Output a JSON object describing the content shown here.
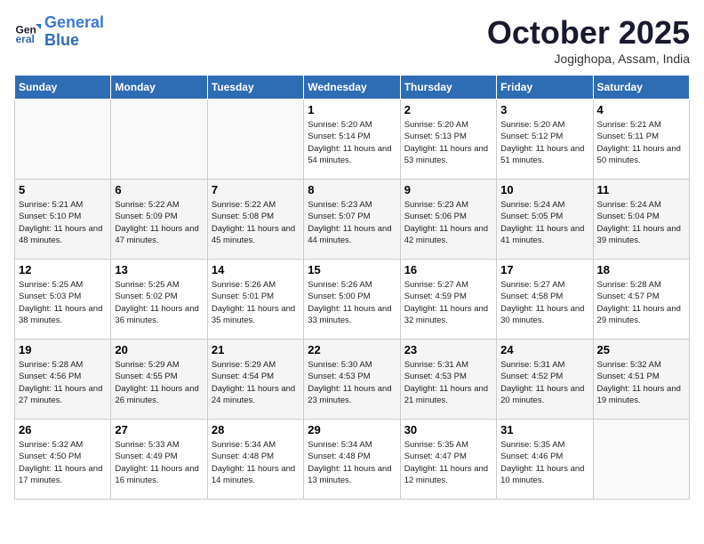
{
  "logo": {
    "line1": "General",
    "line2": "Blue"
  },
  "title": "October 2025",
  "subtitle": "Jogighopa, Assam, India",
  "days_of_week": [
    "Sunday",
    "Monday",
    "Tuesday",
    "Wednesday",
    "Thursday",
    "Friday",
    "Saturday"
  ],
  "weeks": [
    [
      {
        "num": "",
        "sunrise": "",
        "sunset": "",
        "daylight": ""
      },
      {
        "num": "",
        "sunrise": "",
        "sunset": "",
        "daylight": ""
      },
      {
        "num": "",
        "sunrise": "",
        "sunset": "",
        "daylight": ""
      },
      {
        "num": "1",
        "sunrise": "Sunrise: 5:20 AM",
        "sunset": "Sunset: 5:14 PM",
        "daylight": "Daylight: 11 hours and 54 minutes."
      },
      {
        "num": "2",
        "sunrise": "Sunrise: 5:20 AM",
        "sunset": "Sunset: 5:13 PM",
        "daylight": "Daylight: 11 hours and 53 minutes."
      },
      {
        "num": "3",
        "sunrise": "Sunrise: 5:20 AM",
        "sunset": "Sunset: 5:12 PM",
        "daylight": "Daylight: 11 hours and 51 minutes."
      },
      {
        "num": "4",
        "sunrise": "Sunrise: 5:21 AM",
        "sunset": "Sunset: 5:11 PM",
        "daylight": "Daylight: 11 hours and 50 minutes."
      }
    ],
    [
      {
        "num": "5",
        "sunrise": "Sunrise: 5:21 AM",
        "sunset": "Sunset: 5:10 PM",
        "daylight": "Daylight: 11 hours and 48 minutes."
      },
      {
        "num": "6",
        "sunrise": "Sunrise: 5:22 AM",
        "sunset": "Sunset: 5:09 PM",
        "daylight": "Daylight: 11 hours and 47 minutes."
      },
      {
        "num": "7",
        "sunrise": "Sunrise: 5:22 AM",
        "sunset": "Sunset: 5:08 PM",
        "daylight": "Daylight: 11 hours and 45 minutes."
      },
      {
        "num": "8",
        "sunrise": "Sunrise: 5:23 AM",
        "sunset": "Sunset: 5:07 PM",
        "daylight": "Daylight: 11 hours and 44 minutes."
      },
      {
        "num": "9",
        "sunrise": "Sunrise: 5:23 AM",
        "sunset": "Sunset: 5:06 PM",
        "daylight": "Daylight: 11 hours and 42 minutes."
      },
      {
        "num": "10",
        "sunrise": "Sunrise: 5:24 AM",
        "sunset": "Sunset: 5:05 PM",
        "daylight": "Daylight: 11 hours and 41 minutes."
      },
      {
        "num": "11",
        "sunrise": "Sunrise: 5:24 AM",
        "sunset": "Sunset: 5:04 PM",
        "daylight": "Daylight: 11 hours and 39 minutes."
      }
    ],
    [
      {
        "num": "12",
        "sunrise": "Sunrise: 5:25 AM",
        "sunset": "Sunset: 5:03 PM",
        "daylight": "Daylight: 11 hours and 38 minutes."
      },
      {
        "num": "13",
        "sunrise": "Sunrise: 5:25 AM",
        "sunset": "Sunset: 5:02 PM",
        "daylight": "Daylight: 11 hours and 36 minutes."
      },
      {
        "num": "14",
        "sunrise": "Sunrise: 5:26 AM",
        "sunset": "Sunset: 5:01 PM",
        "daylight": "Daylight: 11 hours and 35 minutes."
      },
      {
        "num": "15",
        "sunrise": "Sunrise: 5:26 AM",
        "sunset": "Sunset: 5:00 PM",
        "daylight": "Daylight: 11 hours and 33 minutes."
      },
      {
        "num": "16",
        "sunrise": "Sunrise: 5:27 AM",
        "sunset": "Sunset: 4:59 PM",
        "daylight": "Daylight: 11 hours and 32 minutes."
      },
      {
        "num": "17",
        "sunrise": "Sunrise: 5:27 AM",
        "sunset": "Sunset: 4:58 PM",
        "daylight": "Daylight: 11 hours and 30 minutes."
      },
      {
        "num": "18",
        "sunrise": "Sunrise: 5:28 AM",
        "sunset": "Sunset: 4:57 PM",
        "daylight": "Daylight: 11 hours and 29 minutes."
      }
    ],
    [
      {
        "num": "19",
        "sunrise": "Sunrise: 5:28 AM",
        "sunset": "Sunset: 4:56 PM",
        "daylight": "Daylight: 11 hours and 27 minutes."
      },
      {
        "num": "20",
        "sunrise": "Sunrise: 5:29 AM",
        "sunset": "Sunset: 4:55 PM",
        "daylight": "Daylight: 11 hours and 26 minutes."
      },
      {
        "num": "21",
        "sunrise": "Sunrise: 5:29 AM",
        "sunset": "Sunset: 4:54 PM",
        "daylight": "Daylight: 11 hours and 24 minutes."
      },
      {
        "num": "22",
        "sunrise": "Sunrise: 5:30 AM",
        "sunset": "Sunset: 4:53 PM",
        "daylight": "Daylight: 11 hours and 23 minutes."
      },
      {
        "num": "23",
        "sunrise": "Sunrise: 5:31 AM",
        "sunset": "Sunset: 4:53 PM",
        "daylight": "Daylight: 11 hours and 21 minutes."
      },
      {
        "num": "24",
        "sunrise": "Sunrise: 5:31 AM",
        "sunset": "Sunset: 4:52 PM",
        "daylight": "Daylight: 11 hours and 20 minutes."
      },
      {
        "num": "25",
        "sunrise": "Sunrise: 5:32 AM",
        "sunset": "Sunset: 4:51 PM",
        "daylight": "Daylight: 11 hours and 19 minutes."
      }
    ],
    [
      {
        "num": "26",
        "sunrise": "Sunrise: 5:32 AM",
        "sunset": "Sunset: 4:50 PM",
        "daylight": "Daylight: 11 hours and 17 minutes."
      },
      {
        "num": "27",
        "sunrise": "Sunrise: 5:33 AM",
        "sunset": "Sunset: 4:49 PM",
        "daylight": "Daylight: 11 hours and 16 minutes."
      },
      {
        "num": "28",
        "sunrise": "Sunrise: 5:34 AM",
        "sunset": "Sunset: 4:48 PM",
        "daylight": "Daylight: 11 hours and 14 minutes."
      },
      {
        "num": "29",
        "sunrise": "Sunrise: 5:34 AM",
        "sunset": "Sunset: 4:48 PM",
        "daylight": "Daylight: 11 hours and 13 minutes."
      },
      {
        "num": "30",
        "sunrise": "Sunrise: 5:35 AM",
        "sunset": "Sunset: 4:47 PM",
        "daylight": "Daylight: 11 hours and 12 minutes."
      },
      {
        "num": "31",
        "sunrise": "Sunrise: 5:35 AM",
        "sunset": "Sunset: 4:46 PM",
        "daylight": "Daylight: 11 hours and 10 minutes."
      },
      {
        "num": "",
        "sunrise": "",
        "sunset": "",
        "daylight": ""
      }
    ]
  ]
}
